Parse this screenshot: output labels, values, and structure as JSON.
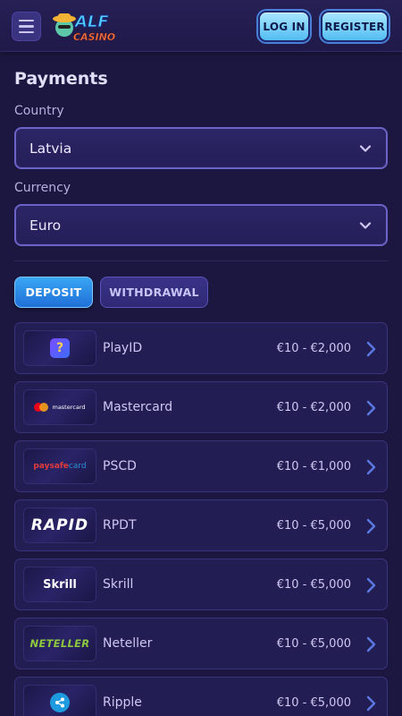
{
  "header": {
    "logo_top": "ALF",
    "logo_bottom": "CASINO",
    "login_label": "LOG IN",
    "register_label": "REGISTER"
  },
  "main": {
    "title": "Payments",
    "country_label": "Country",
    "country_value": "Latvia",
    "currency_label": "Currency",
    "currency_value": "Euro",
    "tabs": [
      {
        "label": "DEPOSIT",
        "active": true
      },
      {
        "label": "WITHDRAWAL",
        "active": false
      }
    ]
  },
  "payments": [
    {
      "name": "PlayID",
      "range": "€10 - €2,000",
      "logo_icon": "playid-logo",
      "logo_text": "?"
    },
    {
      "name": "Mastercard",
      "range": "€10 - €2,000",
      "logo_icon": "mastercard-logo",
      "logo_text": "mastercard"
    },
    {
      "name": "PSCD",
      "range": "€10 - €1,000",
      "logo_icon": "paysafecard-logo",
      "logo_text_a": "paysafe",
      "logo_text_b": "card"
    },
    {
      "name": "RPDT",
      "range": "€10 - €5,000",
      "logo_icon": "rapid-logo",
      "logo_text": "RAPID"
    },
    {
      "name": "Skrill",
      "range": "€10 - €5,000",
      "logo_icon": "skrill-logo",
      "logo_text": "Skrill"
    },
    {
      "name": "Neteller",
      "range": "€10 - €5,000",
      "logo_icon": "neteller-logo",
      "logo_text": "NETELLER"
    },
    {
      "name": "Ripple",
      "range": "€10 - €5,000",
      "logo_icon": "ripple-logo"
    }
  ],
  "colors": {
    "background": "#1c1740",
    "accent_blue": "#3aa6f5",
    "card_border": "#39337c",
    "select_border": "#6c63c8"
  }
}
